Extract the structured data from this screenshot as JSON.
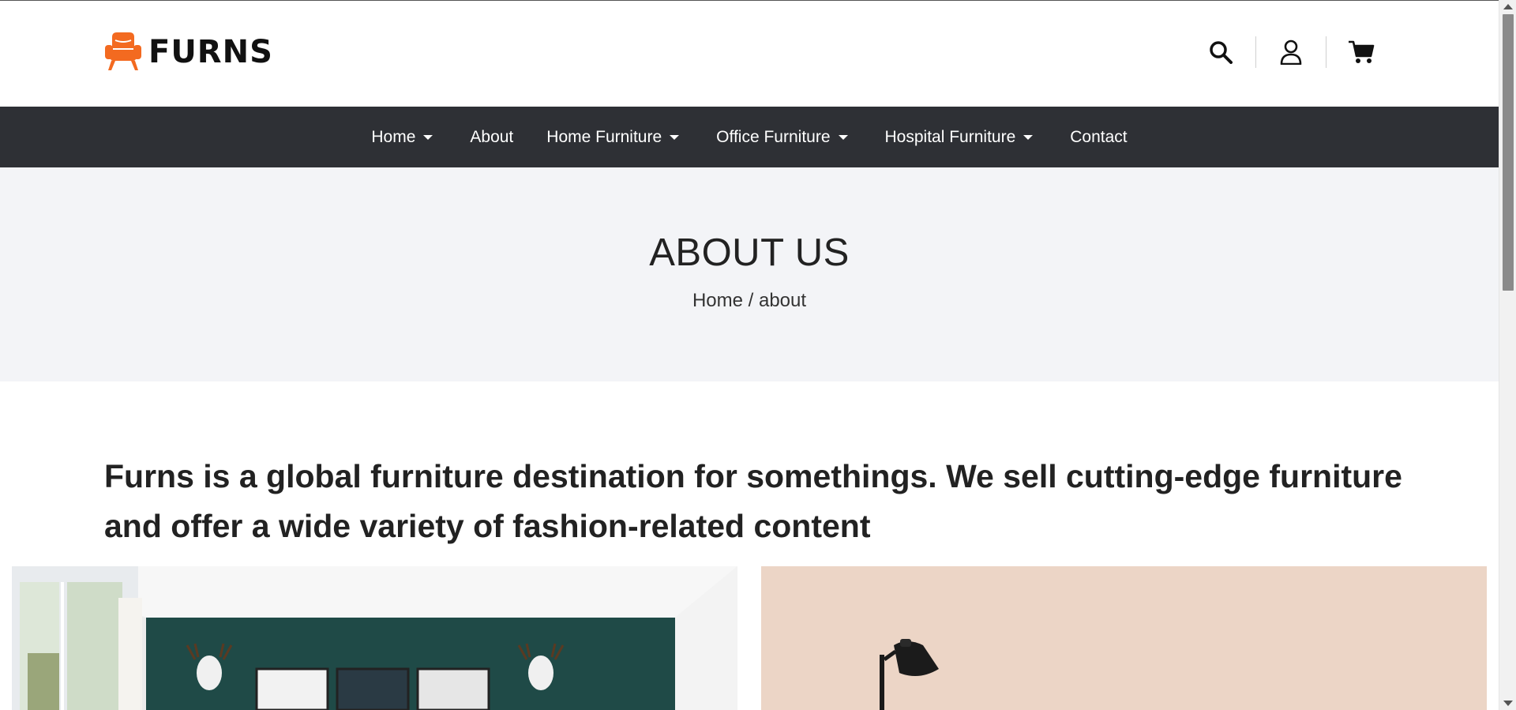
{
  "brand": {
    "name": "FURNS",
    "logo_icon": "armchair-icon",
    "accent_color": "#f36a20"
  },
  "header": {
    "actions": [
      {
        "icon": "search-icon"
      },
      {
        "icon": "user-icon"
      },
      {
        "icon": "cart-icon"
      }
    ]
  },
  "nav": {
    "items": [
      {
        "label": "Home",
        "dropdown": true
      },
      {
        "label": "About",
        "dropdown": false
      },
      {
        "label": "Home Furniture",
        "dropdown": true
      },
      {
        "label": "Office Furniture",
        "dropdown": true
      },
      {
        "label": "Hospital Furniture",
        "dropdown": true
      },
      {
        "label": "Contact",
        "dropdown": false
      }
    ],
    "background": "#2e3035"
  },
  "page": {
    "title": "ABOUT US",
    "breadcrumb": {
      "home": "Home",
      "separator": " / ",
      "current": "about"
    }
  },
  "intro": {
    "text": "Furns is a global furniture destination for somethings. We sell cutting-edge furniture and offer a wide variety of fashion-related content"
  }
}
